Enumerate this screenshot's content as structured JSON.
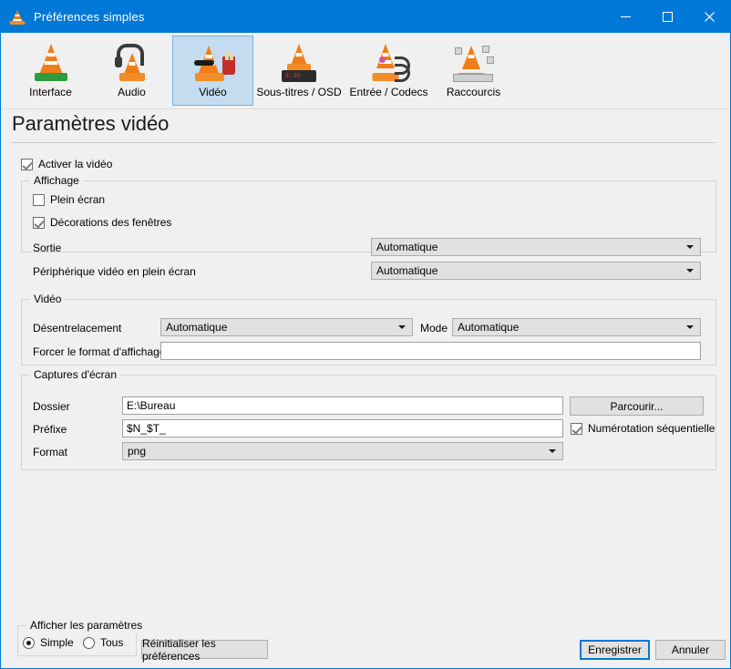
{
  "window": {
    "title": "Préférences simples",
    "icon": "vlc-cone-icon",
    "accent_color": "#0078d7",
    "background_color": "#f0f0f0",
    "controls": {
      "minimize": "minimize-icon",
      "maximize": "maximize-icon",
      "close": "close-icon"
    }
  },
  "toolbar": {
    "tabs": [
      {
        "label": "Interface",
        "icon": "vlc-interface-icon",
        "selected": false
      },
      {
        "label": "Audio",
        "icon": "vlc-audio-icon",
        "selected": false
      },
      {
        "label": "Vidéo",
        "icon": "vlc-video-icon",
        "selected": true
      },
      {
        "label": "Sous-titres / OSD",
        "icon": "vlc-subtitles-osd-icon",
        "selected": false
      },
      {
        "label": "Entrée / Codecs",
        "icon": "vlc-input-codecs-icon",
        "selected": false
      },
      {
        "label": "Raccourcis",
        "icon": "vlc-hotkeys-icon",
        "selected": false
      }
    ],
    "selected_index": 2
  },
  "page": {
    "title": "Paramètres vidéo",
    "enable_video": {
      "label": "Activer la vidéo",
      "checked": true
    }
  },
  "display_group": {
    "title": "Affichage",
    "fullscreen": {
      "label": "Plein écran",
      "checked": false
    },
    "window_decorations": {
      "label": "Décorations des fenêtres",
      "checked": true
    },
    "output": {
      "label": "Sortie",
      "value": "Automatique"
    },
    "fullscreen_device": {
      "label": "Périphérique vidéo en plein écran",
      "value": "Automatique"
    }
  },
  "video_group": {
    "title": "Vidéo",
    "deinterlacing": {
      "label": "Désentrelacement",
      "value": "Automatique"
    },
    "mode": {
      "label": "Mode",
      "value": "Automatique"
    },
    "force_aspect": {
      "label": "Forcer le format d'affichage",
      "value": ""
    }
  },
  "snapshots_group": {
    "title": "Captures d'écran",
    "directory": {
      "label": "Dossier",
      "value": "E:\\Bureau"
    },
    "browse_button": "Parcourir...",
    "prefix": {
      "label": "Préfixe",
      "value": "$N_$T_"
    },
    "sequential": {
      "label": "Numérotation séquentielle",
      "checked": true
    },
    "format": {
      "label": "Format",
      "value": "png"
    }
  },
  "footer": {
    "show_settings": {
      "title": "Afficher les paramètres",
      "options": [
        {
          "label": "Simple",
          "selected": true
        },
        {
          "label": "Tous",
          "selected": false
        }
      ]
    },
    "reset_button": "Réinitialiser les préférences",
    "save_button": "Enregistrer",
    "cancel_button": "Annuler"
  }
}
